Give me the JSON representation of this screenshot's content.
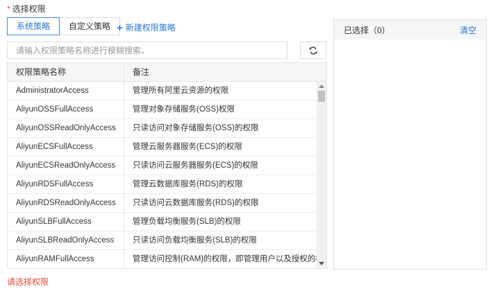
{
  "form": {
    "required_mark": "*",
    "label": "选择权限",
    "error": "请选择权限"
  },
  "tabs": [
    {
      "label": "系统策略",
      "active": true
    },
    {
      "label": "自定义策略",
      "active": false
    }
  ],
  "new_policy": {
    "plus": "+",
    "label": "新建权限策略"
  },
  "search": {
    "placeholder": "请输入权限策略名称进行模糊搜索。",
    "value": ""
  },
  "refresh": {
    "icon": "refresh-icon"
  },
  "table": {
    "headers": [
      "权限策略名称",
      "备注"
    ],
    "rows": [
      {
        "name": "AdministratorAccess",
        "note": "管理所有阿里云资源的权限"
      },
      {
        "name": "AliyunOSSFullAccess",
        "note": "管理对象存储服务(OSS)权限"
      },
      {
        "name": "AliyunOSSReadOnlyAccess",
        "note": "只读访问对象存储服务(OSS)的权限"
      },
      {
        "name": "AliyunECSFullAccess",
        "note": "管理云服务器服务(ECS)的权限"
      },
      {
        "name": "AliyunECSReadOnlyAccess",
        "note": "只读访问云服务器服务(ECS)的权限"
      },
      {
        "name": "AliyunRDSFullAccess",
        "note": "管理云数据库服务(RDS)的权限"
      },
      {
        "name": "AliyunRDSReadOnlyAccess",
        "note": "只读访问云数据库服务(RDS)的权限"
      },
      {
        "name": "AliyunSLBFullAccess",
        "note": "管理负载均衡服务(SLB)的权限"
      },
      {
        "name": "AliyunSLBReadOnlyAccess",
        "note": "只读访问负载均衡服务(SLB)的权限"
      },
      {
        "name": "AliyunRAMFullAccess",
        "note": "管理访问控制(RAM)的权限，即管理用户以及授权的权限"
      }
    ]
  },
  "selected": {
    "title": "已选择（0）",
    "clear_label": "清空"
  },
  "colors": {
    "accent": "#2a7ad6",
    "error": "#e84c3d",
    "border": "#dddddd"
  }
}
